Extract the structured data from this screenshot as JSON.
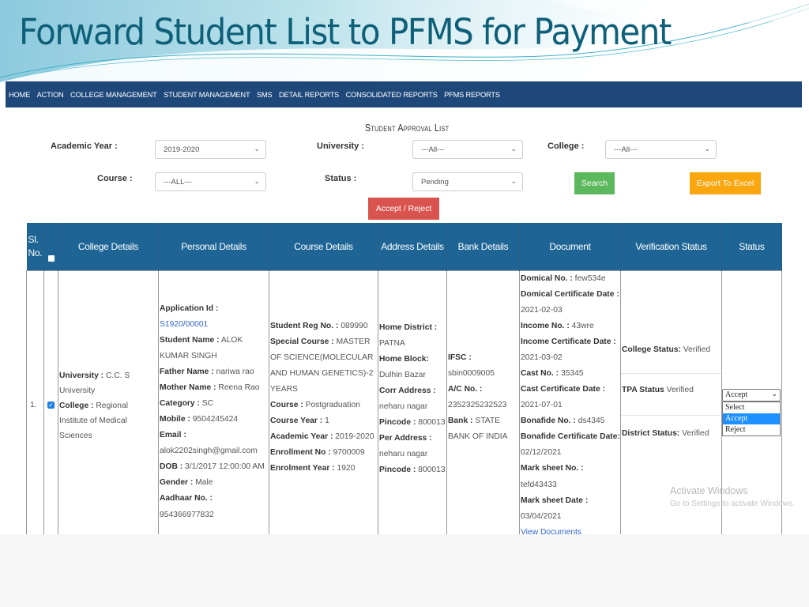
{
  "slide": {
    "title": "Forward Student List to PFMS for Payment"
  },
  "nav": {
    "items": [
      "HOME",
      "ACTION",
      "COLLEGE MANAGEMENT",
      "STUDENT MANAGEMENT",
      "SMS",
      "DETAIL REPORTS",
      "CONSOLIDATED REPORTS",
      "PFMS REPORTS"
    ],
    "background": "#1e487a"
  },
  "page": {
    "title": "Student Approval List"
  },
  "filters": {
    "academic_year": {
      "label": "Academic Year :",
      "value": "2019-2020"
    },
    "university": {
      "label": "University :",
      "value": "---All---"
    },
    "college": {
      "label": "College :",
      "value": "---All---"
    },
    "course": {
      "label": "Course :",
      "value": "---ALL---"
    },
    "status": {
      "label": "Status :",
      "value": "Pending"
    }
  },
  "buttons": {
    "search": "Search",
    "export": "Export To Excel",
    "accept_reject": "Accept / Reject"
  },
  "table": {
    "headers": [
      "Sl. No.",
      "",
      "College Details",
      "Personal Details",
      "Course Details",
      "Address Details",
      "Bank Details",
      "Document",
      "Verification Status",
      "Status"
    ],
    "rows": [
      {
        "sl_no": "1.",
        "checked": true,
        "college": {
          "university_label": "University :",
          "university": "C.C. S University",
          "college_label": "College :",
          "college": "Regional Institute of Medical Sciences"
        },
        "personal": {
          "application_id_label": "Application Id :",
          "application_id": "S1920/00001",
          "student_name_label": "Student Name :",
          "student_name": "ALOK KUMAR SINGH",
          "father_name_label": "Father Name :",
          "father_name": "nariwa rao",
          "mother_name_label": "Mother Name :",
          "mother_name": "Reena Rao",
          "category_label": "Category :",
          "category": "SC",
          "mobile_label": "Mobile :",
          "mobile": "9504245424",
          "email_label": "Email :",
          "email": "alok2202singh@gmail.com",
          "dob_label": "DOB :",
          "dob": "3/1/2017 12:00:00 AM",
          "gender_label": "Gender :",
          "gender": "Male",
          "aadhaar_label": "Aadhaar No. :",
          "aadhaar": "954366977832"
        },
        "course": {
          "reg_no_label": "Student Reg No. :",
          "reg_no": "089990",
          "special_course_label": "Special Course :",
          "special_course": "MASTER OF SCIENCE(MOLECULAR AND HUMAN GENETICS)-2 YEARS",
          "course_label": "Course :",
          "course": "Postgraduation",
          "course_year_label": "Course Year :",
          "course_year": "1",
          "academic_year_label": "Academic Year :",
          "academic_year": "2019-2020",
          "enrollment_no_label": "Enrollment No :",
          "enrollment_no": "9700009",
          "enrolment_year_label": "Enrolment Year :",
          "enrolment_year": "1920"
        },
        "address": {
          "home_district_label": "Home District :",
          "home_district": "PATNA",
          "home_block_label": "Home Block:",
          "home_block": "Dulhin Bazar",
          "corr_address_label": "Corr Address :",
          "corr_address": "neharu nagar",
          "corr_pincode_label": "Pincode :",
          "corr_pincode": "800013",
          "per_address_label": "Per Address :",
          "per_address": "neharu nagar",
          "per_pincode_label": "Pincode :",
          "per_pincode": "800013"
        },
        "bank": {
          "ifsc_label": "IFSC :",
          "ifsc": "sbin0009005",
          "ac_no_label": "A/C No. :",
          "ac_no": "2352325232523",
          "bank_label": "Bank :",
          "bank": "STATE BANK OF INDIA"
        },
        "document": {
          "domical_no_label": "Domical No. :",
          "domical_no": "few534e",
          "domical_date_label": "Domical Certificate Date :",
          "domical_date": "2021-02-03",
          "income_no_label": "Income No. :",
          "income_no": "43wre",
          "income_date_label": "Income Certificate Date :",
          "income_date": "2021-03-02",
          "cast_no_label": "Cast No. :",
          "cast_no": "35345",
          "cast_date_label": "Cast Certificate Date :",
          "cast_date": "2021-07-01",
          "bonafide_no_label": "Bonafide No. :",
          "bonafide_no": "ds4345",
          "bonafide_date_label": "Bonafide Certificate Date:",
          "bonafide_date": "02/12/2021",
          "marksheet_no_label": "Mark sheet No. :",
          "marksheet_no": "tefd43433",
          "marksheet_date_label": "Mark sheet Date :",
          "marksheet_date": "03/04/2021",
          "view_documents": "View Documents"
        },
        "verification": {
          "college_label": "College Status:",
          "college": "Verified",
          "tpa_label": "TPA Status",
          "tpa": "Verified",
          "district_label": "District Status:",
          "district": "Verified"
        },
        "status": {
          "selected": "Accept",
          "options": [
            "Select",
            "Accept",
            "Reject"
          ],
          "highlighted": "Accept"
        }
      }
    ]
  },
  "watermark": {
    "line1": "Activate Windows",
    "line2": "Go to Settings to activate Windows."
  }
}
